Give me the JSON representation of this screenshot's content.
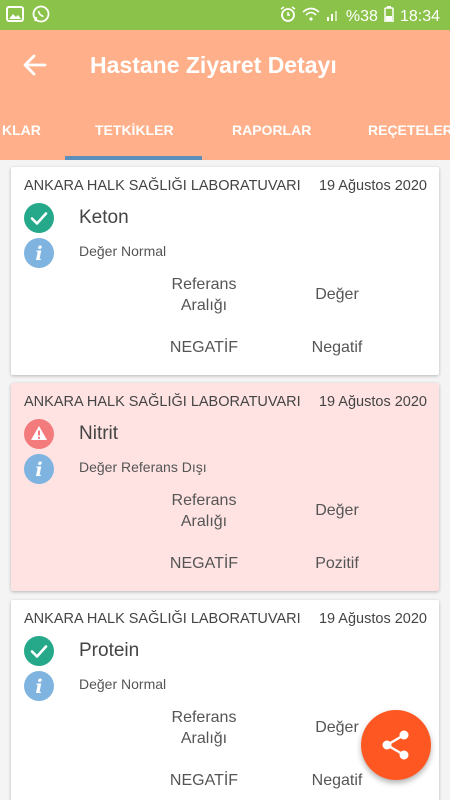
{
  "status_bar": {
    "battery_percent": "%38",
    "time": "18:34",
    "icons": [
      "image-icon",
      "whatsapp-icon",
      "alarm-icon",
      "wifi-icon",
      "signal-icon",
      "battery-icon"
    ]
  },
  "header": {
    "title": "Hastane Ziyaret Detayı",
    "back_icon": "arrow-left-icon"
  },
  "tabs": [
    {
      "label": "KLAR",
      "active": false
    },
    {
      "label": "TETKİKLER",
      "active": true
    },
    {
      "label": "RAPORLAR",
      "active": false
    },
    {
      "label": "REÇETELER",
      "active": false
    }
  ],
  "colors": {
    "status_bar": "#8bc34a",
    "app_bar": "#ffb08a",
    "tab_indicator": "#5b8fb9",
    "ok_green": "#26a98a",
    "warn_red": "#f47b7b",
    "info_blue": "#7fb3e0",
    "warn_card_bg": "#ffe3e3",
    "fab": "#ff5722"
  },
  "results": [
    {
      "lab": "ANKARA HALK SAĞLIĞI LABORATUVARI",
      "date": "19 Ağustos 2020",
      "test": "Keton",
      "status": "ok",
      "note": "Değer Normal",
      "ref_label": "Referans Aralığı",
      "value_label": "Değer",
      "ref_value": "NEGATİF",
      "value": "Negatif"
    },
    {
      "lab": "ANKARA HALK SAĞLIĞI LABORATUVARI",
      "date": "19 Ağustos 2020",
      "test": "Nitrit",
      "status": "warning",
      "note": "Değer Referans Dışı",
      "ref_label": "Referans Aralığı",
      "value_label": "Değer",
      "ref_value": "NEGATİF",
      "value": "Pozitif"
    },
    {
      "lab": "ANKARA HALK SAĞLIĞI LABORATUVARI",
      "date": "19 Ağustos 2020",
      "test": "Protein",
      "status": "ok",
      "note": "Değer Normal",
      "ref_label": "Referans Aralığı",
      "value_label": "Değer",
      "ref_value": "NEGATİF",
      "value": "Negatif"
    }
  ],
  "fab": {
    "icon": "share-icon"
  }
}
